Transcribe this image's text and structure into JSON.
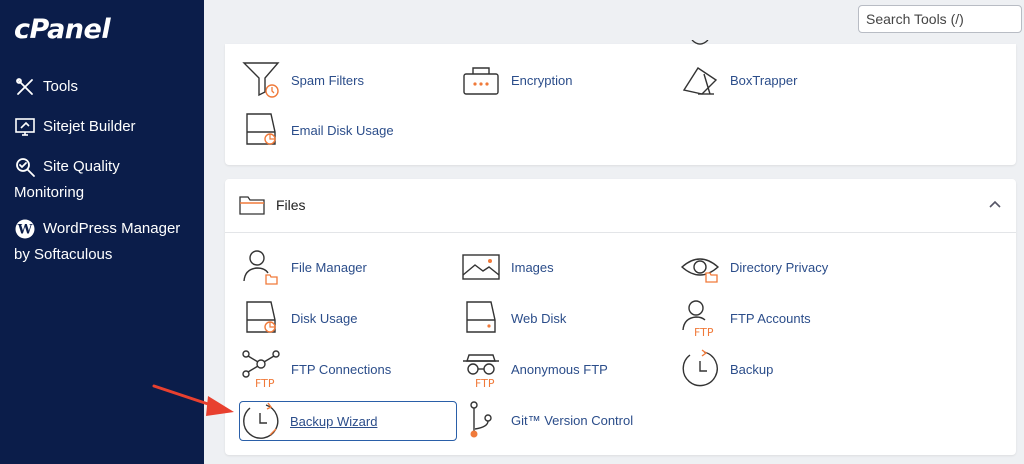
{
  "sidebar": {
    "logo": "cPanel",
    "items": [
      {
        "label": "Tools"
      },
      {
        "label": "Sitejet Builder"
      },
      {
        "label": "Site Quality",
        "label2": "Monitoring"
      },
      {
        "label": "WordPress Manager",
        "label2": "by Softaculous"
      }
    ]
  },
  "search": {
    "placeholder": "Search Tools (/)"
  },
  "email": {
    "tools": [
      {
        "label": "Spam Filters"
      },
      {
        "label": "Encryption"
      },
      {
        "label": "BoxTrapper"
      },
      {
        "label": "Email Disk Usage"
      }
    ]
  },
  "files": {
    "title": "Files",
    "tools": [
      {
        "label": "File Manager"
      },
      {
        "label": "Images"
      },
      {
        "label": "Directory Privacy"
      },
      {
        "label": "Disk Usage"
      },
      {
        "label": "Web Disk"
      },
      {
        "label": "FTP Accounts"
      },
      {
        "label": "FTP Connections"
      },
      {
        "label": "Anonymous FTP"
      },
      {
        "label": "Backup"
      },
      {
        "label": "Backup Wizard"
      },
      {
        "label": "Git™ Version Control"
      }
    ],
    "ftp_tag": "FTP"
  },
  "colors": {
    "sidebar": "#0b1d4a",
    "accent": "#f07a3a",
    "link": "#2b4d8a",
    "arrow": "#e8402f"
  }
}
